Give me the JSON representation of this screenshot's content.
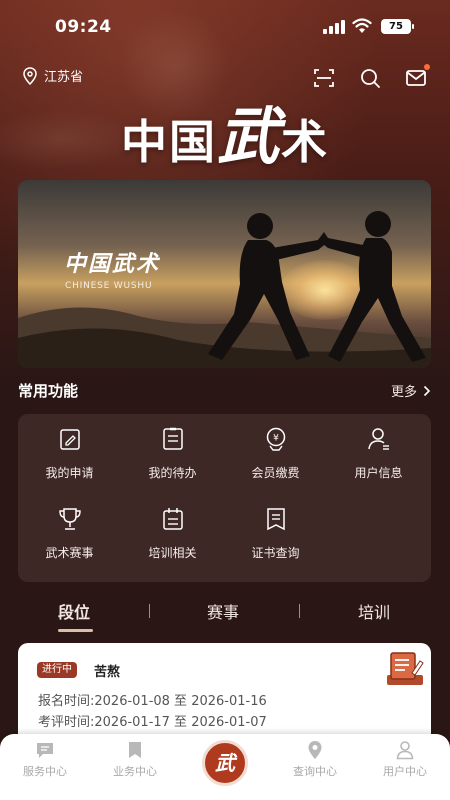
{
  "status_bar": {
    "time": "09:24",
    "battery": "75"
  },
  "header": {
    "location": "江苏省",
    "brand_chars": [
      "中国",
      "武",
      "术"
    ]
  },
  "banner": {
    "title": "中国武术",
    "subtitle": "CHINESE WUSHU"
  },
  "common": {
    "title": "常用功能",
    "more": "更多",
    "items": [
      {
        "label": "我的申请",
        "icon": "edit-document-icon"
      },
      {
        "label": "我的待办",
        "icon": "todo-list-icon"
      },
      {
        "label": "会员缴费",
        "icon": "payment-icon"
      },
      {
        "label": "用户信息",
        "icon": "user-info-icon"
      },
      {
        "label": "武术赛事",
        "icon": "trophy-icon"
      },
      {
        "label": "培训相关",
        "icon": "calendar-icon"
      },
      {
        "label": "证书查询",
        "icon": "certificate-icon"
      }
    ]
  },
  "tabs": [
    {
      "label": "段位",
      "active": true
    },
    {
      "label": "赛事",
      "active": false
    },
    {
      "label": "培训",
      "active": false
    }
  ],
  "event": {
    "badge": "进行中",
    "name": "苦熬",
    "signup": "报名时间:2026-01-08 至 2026-01-16",
    "review": "考评时间:2026-01-17 至 2026-01-07"
  },
  "bottom_nav": {
    "items": [
      {
        "label": "服务中心",
        "icon": "chat-icon"
      },
      {
        "label": "业务中心",
        "icon": "bookmark-icon"
      },
      {
        "label": "查询中心",
        "icon": "location-pin-icon"
      },
      {
        "label": "用户中心",
        "icon": "user-icon"
      }
    ],
    "center_char": "武"
  },
  "colors": {
    "accent": "#b03a1e",
    "background": "#2a1715",
    "card": "#3e2826"
  }
}
